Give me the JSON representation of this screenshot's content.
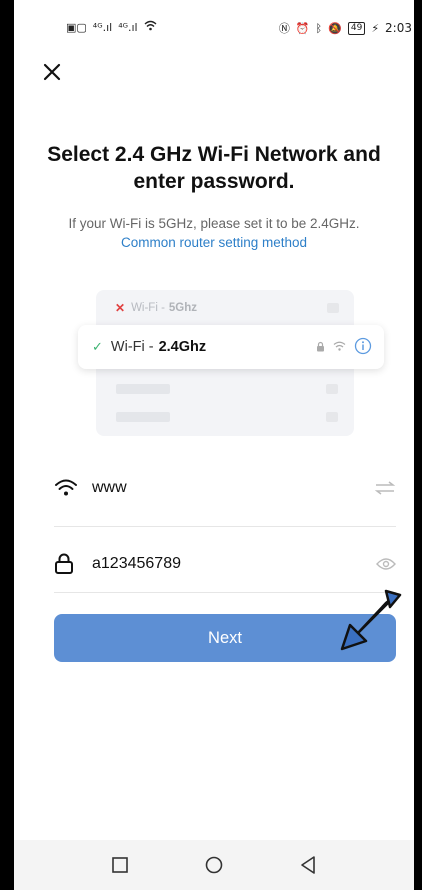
{
  "status_bar": {
    "left_icons": [
      "HD",
      "4G",
      "4G",
      "wifi-signal"
    ],
    "right_icons": [
      "nfc",
      "alarm",
      "bluetooth",
      "mute"
    ],
    "battery": "49",
    "time": "2:03"
  },
  "title": "Select 2.4 GHz Wi-Fi Network and enter password.",
  "subtitle_text": "If your Wi-Fi is 5GHz, please set it to be 2.4GHz.",
  "subtitle_link": "Common router setting method",
  "illustration": {
    "bad_prefix": "Wi-Fi - ",
    "bad_band": "5Ghz",
    "good_prefix": "Wi-Fi - ",
    "good_band": "2.4Ghz"
  },
  "wifi_field": {
    "value": "www",
    "icon": "wifi-icon",
    "action_icon": "switch-network-icon"
  },
  "password_field": {
    "value": "a123456789",
    "icon": "lock-icon",
    "action_icon": "eye-icon"
  },
  "next_label": "Next",
  "colors": {
    "primary": "#5d8fd4",
    "link": "#2d7fc8",
    "check": "#3cb371",
    "cross": "#e04040"
  }
}
